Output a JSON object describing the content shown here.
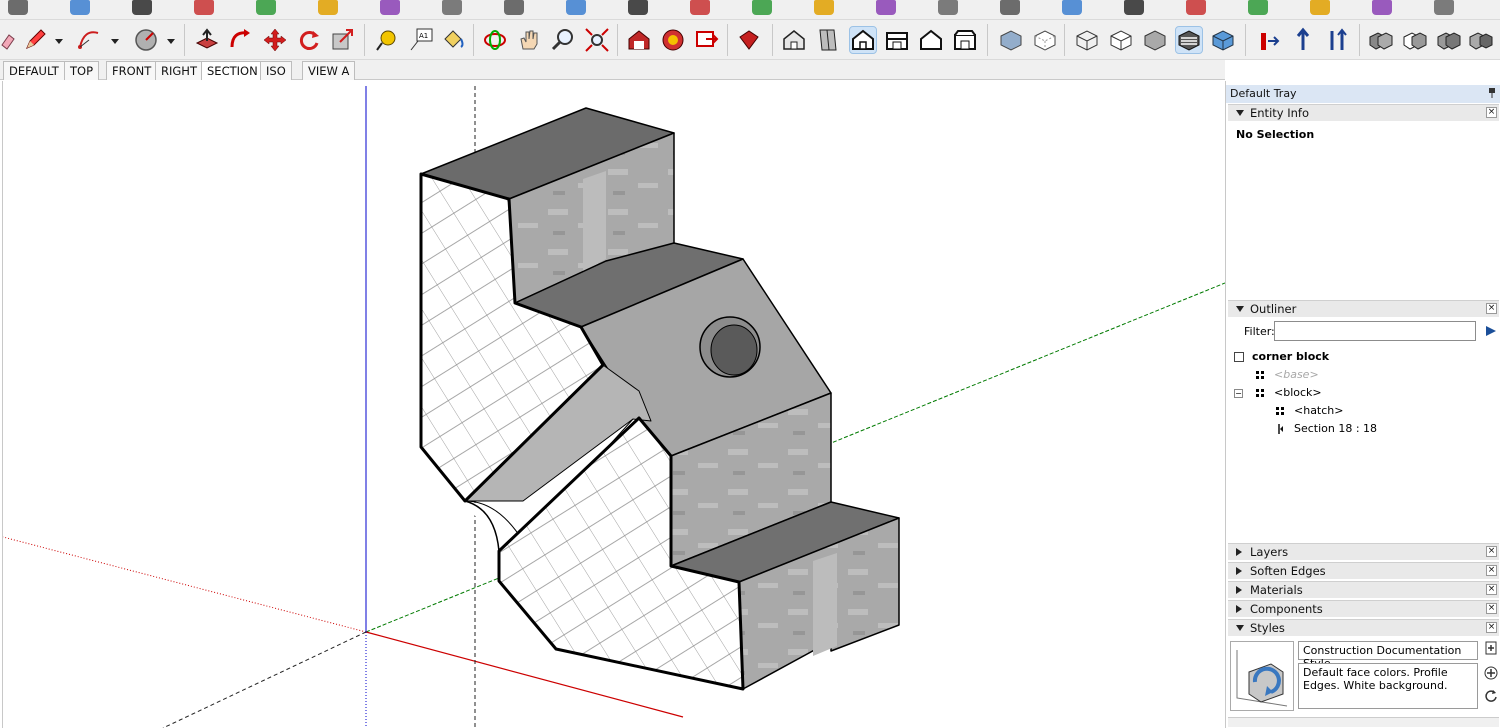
{
  "toolbar": {
    "row1_icon_count": 24,
    "drawing_tools": [
      "pencil-icon",
      "arc-icon",
      "circle-icon",
      "push-pull-icon",
      "follow-me-icon",
      "move-icon",
      "rotate-icon",
      "scale-icon",
      "tape-measure-icon",
      "text-icon",
      "paint-bucket-icon",
      "orbit-icon",
      "pan-icon",
      "zoom-icon",
      "zoom-extents-icon"
    ],
    "view_tools": [
      "iso-view-icon",
      "top-view-icon",
      "front-view-icon",
      "right-view-icon",
      "back-view-icon",
      "left-view-icon"
    ],
    "face_styles": [
      "xray-icon",
      "back-edges-icon",
      "wireframe-icon",
      "hidden-line-icon",
      "shaded-icon",
      "shaded-textures-icon",
      "monochrome-icon"
    ],
    "accent": "#2a6fbf"
  },
  "scene_tabs": [
    "DEFAULT",
    "TOP",
    "FRONT",
    "RIGHT",
    "SECTION",
    "ISO",
    "VIEW A"
  ],
  "active_scene": "SECTION",
  "tray": {
    "title": "Default Tray",
    "entity_info": {
      "header": "Entity Info",
      "status": "No Selection"
    },
    "outliner": {
      "header": "Outliner",
      "filter_label": "Filter:",
      "filter_value": "",
      "root": "corner block",
      "items": [
        "<base>",
        "<block>",
        "<hatch>",
        "Section 18 : 18"
      ]
    },
    "collapsed_panels": [
      "Layers",
      "Soften Edges",
      "Materials",
      "Components"
    ],
    "styles": {
      "header": "Styles",
      "name": "Construction Documentation Style",
      "description": "Default face colors. Profile Edges. White background."
    }
  },
  "colors": {
    "toolbar_bg": "#f0f0f0",
    "axis_red": "#cc0000",
    "axis_green": "#007a00",
    "axis_blue": "#0000cc",
    "model_face": "#a8a8a8",
    "model_dark": "#6e6e6e",
    "section_fill": "#ffffff"
  }
}
